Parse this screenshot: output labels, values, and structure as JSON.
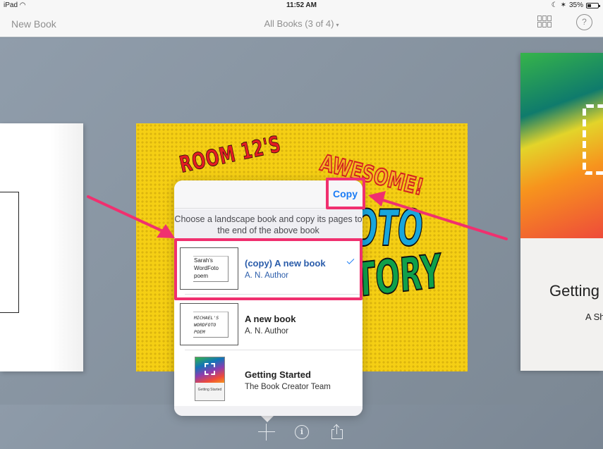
{
  "status_bar": {
    "device": "iPad",
    "wifi_icon": "wifi-icon",
    "time": "11:52 AM",
    "moon_icon": "moon-icon",
    "bluetooth_icon": "bluetooth-icon",
    "battery_percent": "35%",
    "battery_level": 0.35
  },
  "nav": {
    "left_button": "New Book",
    "title": "All Books (3 of 4)",
    "title_caret": "▾",
    "grid_icon": "grid-view-icon",
    "help_label": "?"
  },
  "carousel": {
    "center_book": {
      "line1": "ROOM 12'S",
      "line2": "AWESOME!",
      "line3": "FOTO",
      "line4": "STORY"
    },
    "right_book": {
      "title": "Getting Started",
      "subtitle": "A Short Guide"
    }
  },
  "popover": {
    "copy_button": "Copy",
    "instructions": "Choose a landscape book and copy its pages to the end of the above book",
    "books": [
      {
        "title": "(copy) A new book",
        "author": "A. N. Author",
        "thumb_lines": [
          "Sarah's",
          "WordFoto",
          "poem"
        ],
        "selected": true
      },
      {
        "title": "A new book",
        "author": "A. N. Author",
        "thumb_lines": [
          "MICHAEL'S",
          "WORDFOTO",
          "POEM"
        ],
        "selected": false
      },
      {
        "title": "Getting Started",
        "author": "The Book Creator Team",
        "thumb_label": "Getting Started",
        "selected": false
      }
    ]
  },
  "toolbar": {
    "add_icon": "plus-icon",
    "info_label": "i",
    "share_icon": "share-icon"
  },
  "annotations": {
    "highlight_color": "#f0306f"
  }
}
